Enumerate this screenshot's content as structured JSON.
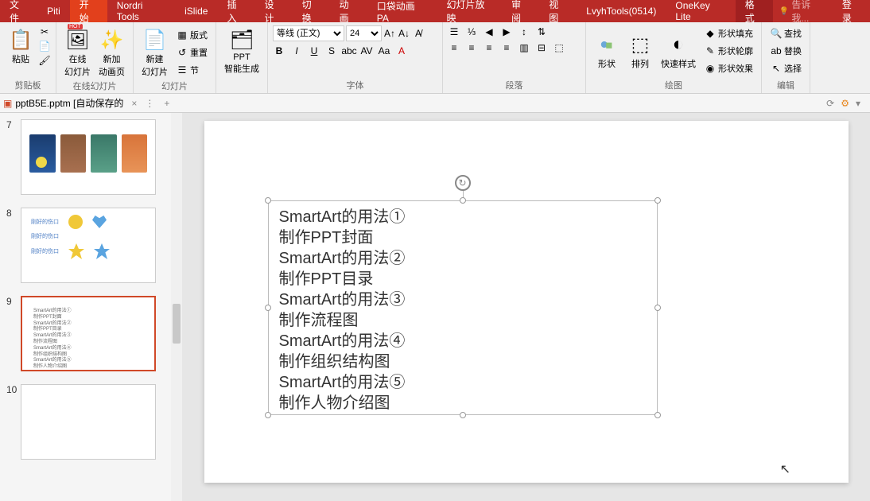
{
  "menu": {
    "file": "文件",
    "piti": "Piti",
    "home": "开始",
    "nordri": "Nordri Tools",
    "islide": "iSlide",
    "insert": "插入",
    "design": "设计",
    "transitions": "切换",
    "animations": "动画",
    "pocket": "口袋动画 PA",
    "slideshow": "幻灯片放映",
    "review": "审阅",
    "view": "视图",
    "lvyh": "LvyhTools(0514)",
    "onekey": "OneKey Lite",
    "format": "格式",
    "tell_me": "告诉我...",
    "login": "登录"
  },
  "ribbon": {
    "clipboard": {
      "paste": "粘贴",
      "label": "剪贴板"
    },
    "slides": {
      "online": "在线\n幻灯片",
      "addAnim": "新加\n动画页",
      "hot": "HOT",
      "new": "新建\n幻灯片",
      "layout": "版式",
      "reset": "重置",
      "section": "节",
      "label": "在线幻灯片",
      "label2": "幻灯片"
    },
    "ppt": {
      "gen": "PPT\n智能生成"
    },
    "font": {
      "name": "等线 (正文)",
      "size": "24",
      "label": "字体"
    },
    "paragraph": {
      "label": "段落"
    },
    "drawing": {
      "shapes": "形状",
      "arrange": "排列",
      "quickstyle": "快速样式",
      "fill": "形状填充",
      "outline": "形状轮廓",
      "effects": "形状效果",
      "label": "绘图"
    },
    "editing": {
      "find": "查找",
      "replace": "替换",
      "select": "选择",
      "label": "编辑"
    }
  },
  "doc": {
    "filename": "pptB5E.pptm [自动保存的"
  },
  "thumbs": {
    "slide7": {
      "num": "7"
    },
    "slide8": {
      "num": "8",
      "text": "刚好的伤口"
    },
    "slide9": {
      "num": "9"
    },
    "slide10": {
      "num": "10"
    }
  },
  "textbox": {
    "line1": "SmartArt的用法①",
    "line2": "制作PPT封面",
    "line3": "SmartArt的用法②",
    "line4": "制作PPT目录",
    "line5": "SmartArt的用法③",
    "line6": "制作流程图",
    "line7": "SmartArt的用法④",
    "line8": "制作组织结构图",
    "line9": "SmartArt的用法⑤",
    "line10": "制作人物介绍图"
  }
}
